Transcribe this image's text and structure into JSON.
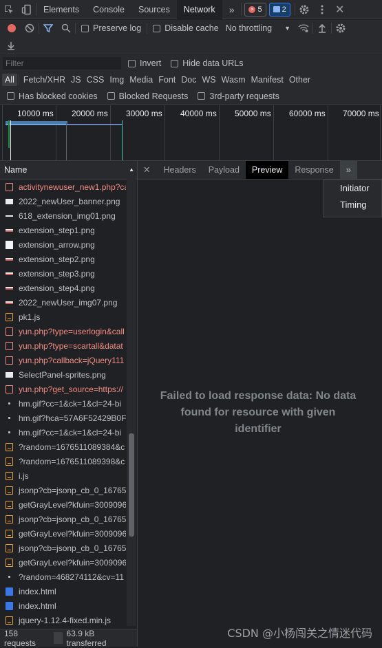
{
  "top_tabs": [
    "Elements",
    "Console",
    "Sources",
    "Network"
  ],
  "active_tab": "Network",
  "badges": {
    "errors": "5",
    "messages": "2"
  },
  "net_toolbar": {
    "preserve_log": "Preserve log",
    "disable_cache": "Disable cache",
    "throttling": "No throttling"
  },
  "filter": {
    "placeholder": "Filter",
    "invert": "Invert",
    "hide_data_urls": "Hide data URLs"
  },
  "types": [
    "All",
    "Fetch/XHR",
    "JS",
    "CSS",
    "Img",
    "Media",
    "Font",
    "Doc",
    "WS",
    "Wasm",
    "Manifest",
    "Other"
  ],
  "active_type": "All",
  "blocked": {
    "has_blocked_cookies": "Has blocked cookies",
    "blocked_requests": "Blocked Requests",
    "third_party": "3rd-party requests"
  },
  "timeline_ticks": [
    "10000 ms",
    "20000 ms",
    "30000 ms",
    "40000 ms",
    "50000 ms",
    "60000 ms",
    "70000 ms"
  ],
  "list_header": "Name",
  "requests": [
    {
      "name": "activitynewuser_new1.php?ca",
      "type": "jserr",
      "error": true
    },
    {
      "name": "2022_newUser_banner.png",
      "type": "img"
    },
    {
      "name": "618_extension_img01.png",
      "type": "line"
    },
    {
      "name": "extension_step1.png",
      "type": "imgred"
    },
    {
      "name": "extension_arrow.png",
      "type": "white"
    },
    {
      "name": "extension_step2.png",
      "type": "imgred"
    },
    {
      "name": "extension_step3.png",
      "type": "imgred"
    },
    {
      "name": "extension_step4.png",
      "type": "imgred"
    },
    {
      "name": "2022_newUser_img07.png",
      "type": "imgred"
    },
    {
      "name": "pk1.js",
      "type": "js"
    },
    {
      "name": "yun.php?type=userlogin&call",
      "type": "jserr",
      "error": true
    },
    {
      "name": "yun.php?type=scartall&datat",
      "type": "jserr",
      "error": true
    },
    {
      "name": "yun.php?callback=jQuery111",
      "type": "jserr",
      "error": true
    },
    {
      "name": "SelectPanel-sprites.png",
      "type": "img"
    },
    {
      "name": "yun.php?get_source=https://",
      "type": "jserr",
      "error": true
    },
    {
      "name": "hm.gif?cc=1&ck=1&cl=24-bi",
      "type": "dot"
    },
    {
      "name": "hm.gif?hca=57A6F52429B0FE",
      "type": "dot"
    },
    {
      "name": "hm.gif?cc=1&ck=1&cl=24-bi",
      "type": "dot"
    },
    {
      "name": "?random=1676511089384&c",
      "type": "js"
    },
    {
      "name": "?random=1676511089398&c",
      "type": "js"
    },
    {
      "name": "i.js",
      "type": "js"
    },
    {
      "name": "jsonp?cb=jsonp_cb_0_167651",
      "type": "js"
    },
    {
      "name": "getGrayLevel?kfuin=3009096",
      "type": "js"
    },
    {
      "name": "jsonp?cb=jsonp_cb_0_167651",
      "type": "js"
    },
    {
      "name": "getGrayLevel?kfuin=3009096",
      "type": "js"
    },
    {
      "name": "jsonp?cb=jsonp_cb_0_167651",
      "type": "js"
    },
    {
      "name": "getGrayLevel?kfuin=3009096",
      "type": "js"
    },
    {
      "name": "?random=468274112&cv=11",
      "type": "dot"
    },
    {
      "name": "index.html",
      "type": "doc"
    },
    {
      "name": "index.html",
      "type": "doc"
    },
    {
      "name": "jquery-1.12.4-fixed.min.js",
      "type": "js"
    }
  ],
  "status": {
    "requests": "158 requests",
    "transferred": "63.9 kB transferred"
  },
  "detail_tabs": [
    "Headers",
    "Payload",
    "Preview",
    "Response"
  ],
  "active_detail_tab": "Preview",
  "overflow_menu": [
    "Initiator",
    "Timing"
  ],
  "message": "Failed to load response data: No data found for resource with given identifier",
  "watermark": "CSDN @小杨闯关之情迷代码"
}
